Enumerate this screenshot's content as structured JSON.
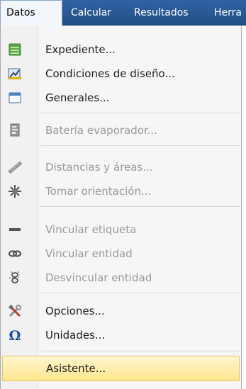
{
  "menubar": {
    "items": [
      {
        "label": "Datos"
      },
      {
        "label": "Calcular"
      },
      {
        "label": "Resultados"
      },
      {
        "label": "Herra"
      }
    ]
  },
  "menu": {
    "items": [
      {
        "label": "Expediente...",
        "icon": "expediente-icon",
        "enabled": true
      },
      {
        "label": "Condiciones de diseño...",
        "icon": "design-conditions-icon",
        "enabled": true
      },
      {
        "label": "Generales...",
        "icon": "window-icon",
        "enabled": true
      },
      {
        "label": "Batería evaporador...",
        "icon": "evaporator-battery-icon",
        "enabled": false
      },
      {
        "label": "Distancias y áreas...",
        "icon": "ruler-icon",
        "enabled": false
      },
      {
        "label": "Tomar orientación...",
        "icon": "compass-icon",
        "enabled": false
      },
      {
        "label": "Vincular etiqueta",
        "icon": "tag-link-icon",
        "enabled": false
      },
      {
        "label": "Vincular entidad",
        "icon": "link-icon",
        "enabled": false
      },
      {
        "label": "Desvincular entidad",
        "icon": "unlink-icon",
        "enabled": false
      },
      {
        "label": "Opciones...",
        "icon": "tools-icon",
        "enabled": true
      },
      {
        "label": "Unidades...",
        "icon": "omega-icon",
        "enabled": true
      },
      {
        "label": "Asistente...",
        "icon": "",
        "enabled": true,
        "highlighted": true
      }
    ]
  },
  "colors": {
    "menubar": "#2f63a3",
    "highlight": "#ffe68e",
    "disabled_text": "#9a9a9a"
  }
}
